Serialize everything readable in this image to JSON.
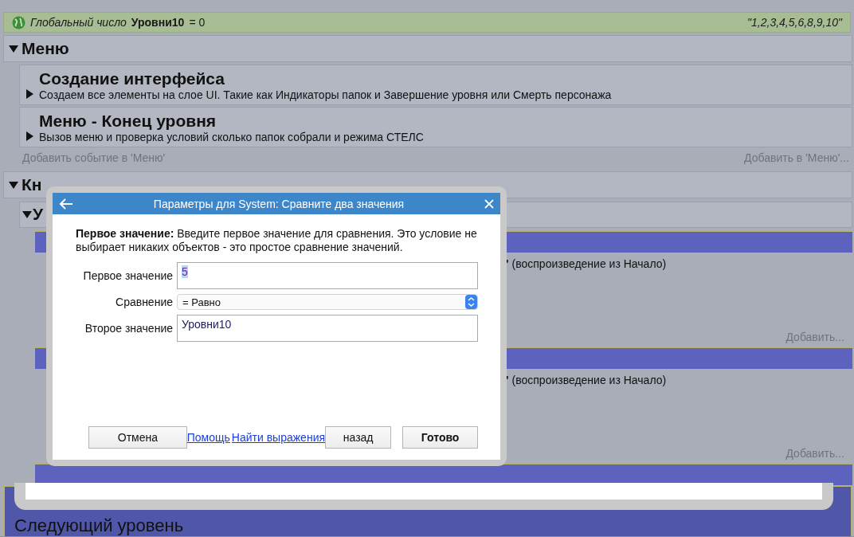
{
  "global_variable": {
    "prefix": "Глобальный число",
    "name": "Уровни10",
    "value": "= 0",
    "comment": "\"1,2,3,4,5,6,8,9,10\""
  },
  "groups": [
    {
      "title": "Меню",
      "expanded": true,
      "events": [
        {
          "title": "Создание интерфейса",
          "description": "Создаем все элементы на слое UI. Такие как Индикаторы папок и Завершение уровня или Смерть персонажа",
          "expanded": false
        },
        {
          "title": "Меню - Конец уровня",
          "description": "Вызов меню и проверка условий сколько папок собрали и режима СТЕЛС",
          "expanded": false
        }
      ],
      "add_event": "Добавить событие в 'Меню'",
      "add_to": "Добавить в 'Меню'..."
    },
    {
      "title": "Кн",
      "expanded": true
    }
  ],
  "subgroup": {
    "title": "У",
    "expanded": true
  },
  "blocks": [
    {
      "kind": "full",
      "action": "**\"** (воспроизведение из Начало)",
      "add": "Добавить..."
    },
    {
      "kind": "full",
      "action": "**\"** (воспроизведение из Начало)",
      "add": "Добавить..."
    },
    {
      "kind": "header"
    }
  ],
  "next_group": {
    "title": "Следующий уровень"
  },
  "dialog": {
    "title": "Параметры для System: Сравните два значения",
    "description": "**Первое значение:** Введите первое значение для сравнения. Это условие не выбирает никаких объектов - это простое сравнение значений.",
    "fields": [
      {
        "kind": "text",
        "label": "Первое значение",
        "value": "5",
        "highlighted": true
      },
      {
        "kind": "select",
        "label": "Сравнение",
        "value": "= Равно"
      },
      {
        "kind": "text",
        "label": "Второе значение",
        "value": "Уровни10",
        "highlighted": false
      }
    ],
    "actions": [
      {
        "kind": "button",
        "label": "Отмена",
        "default": false
      },
      {
        "kind": "link",
        "label": "Помощь"
      },
      {
        "kind": "link",
        "label": "Найти выражения"
      },
      {
        "kind": "button",
        "label": "назад",
        "default": false
      },
      {
        "kind": "button",
        "label": "Готово",
        "default": true
      }
    ]
  }
}
